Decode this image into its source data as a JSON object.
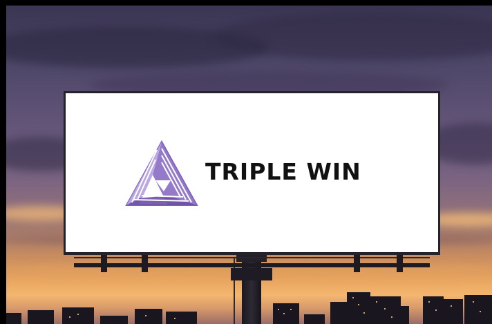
{
  "billboard": {
    "brand_name": "TRIPLE WIN",
    "logo_icon": "purple-triangle-logo",
    "face_color": "#ffffff",
    "text_color": "#111111",
    "logo_colors": [
      "#6b4fa6",
      "#8a6cc4",
      "#b7a2e0"
    ]
  },
  "scene": {
    "sky_top_color": "#3a3552",
    "horizon_color": "#f4b66f",
    "silhouette_color": "#1a1620"
  }
}
